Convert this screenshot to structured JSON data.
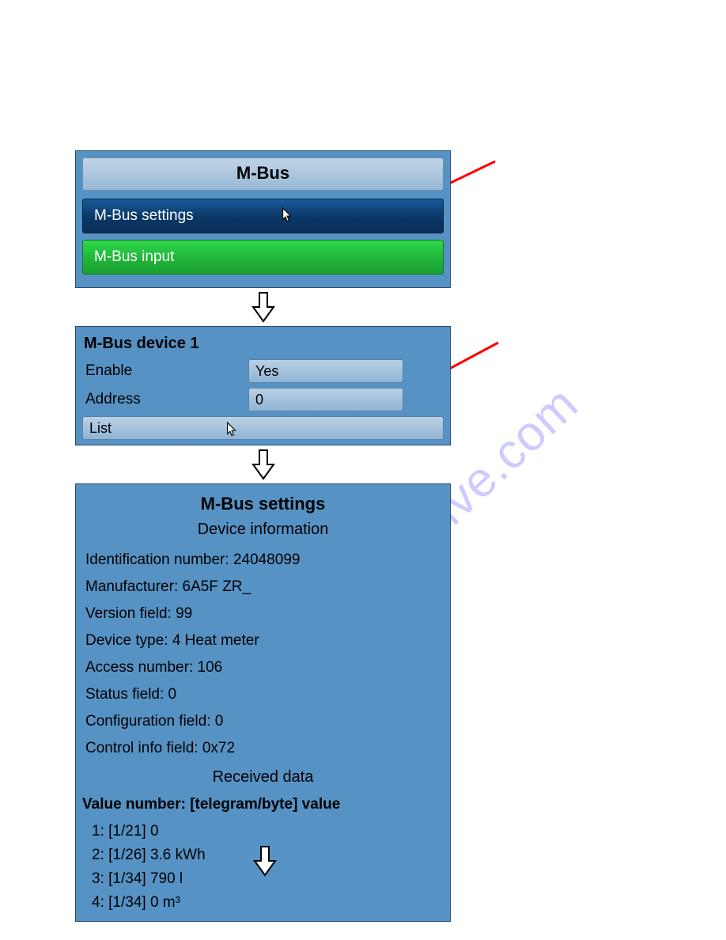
{
  "panel1": {
    "title": "M-Bus",
    "settings_label": "M-Bus settings",
    "input_label": "M-Bus input"
  },
  "panel2": {
    "title": "M-Bus device 1",
    "enable_label": "Enable",
    "enable_value": "Yes",
    "address_label": "Address",
    "address_value": "0",
    "list_label": "List"
  },
  "panel3": {
    "title": "M-Bus settings",
    "subtitle": "Device  information",
    "info": {
      "identification": "Identification number: 24048099",
      "manufacturer": "Manufacturer: 6A5F ZR_",
      "version": "Version field: 99",
      "device_type": "Device type: 4 Heat meter",
      "access_number": "Access number: 106",
      "status_field": "Status field: 0",
      "configuration_field": "Configuration field: 0",
      "control_info": "Control info field: 0x72"
    },
    "received_title": "Received data",
    "value_header": "Value number: [telegram/byte] value",
    "values": {
      "v1": "1: [1/21] 0",
      "v2": "2: [1/26] 3.6 kWh",
      "v3": "3: [1/34] 790 l",
      "v4": "4: [1/34] 0 m³"
    }
  },
  "watermark": "manualshive.com"
}
